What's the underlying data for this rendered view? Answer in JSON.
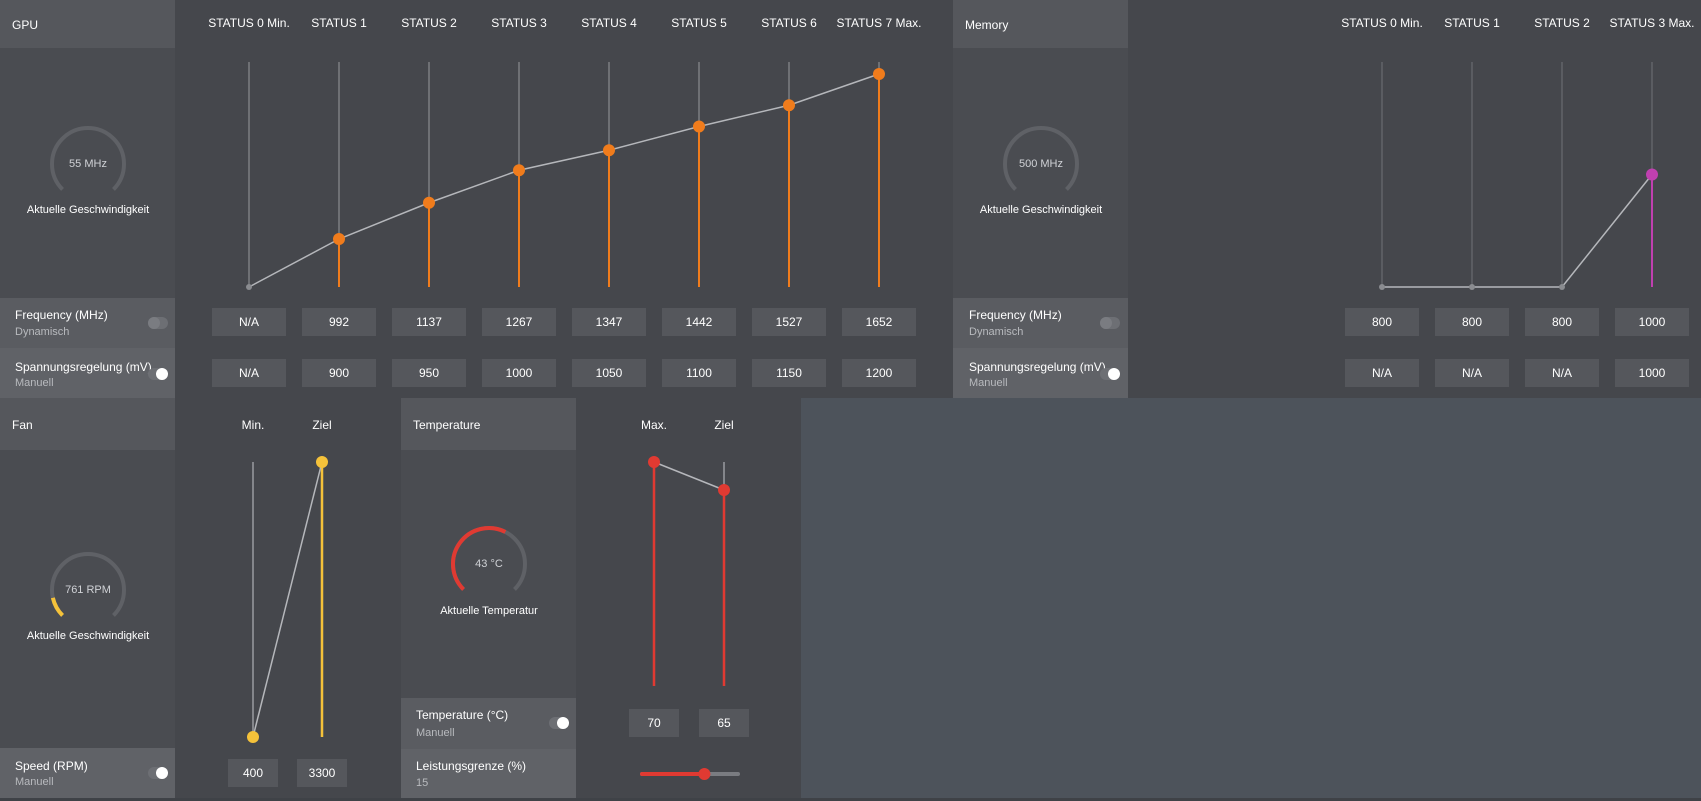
{
  "gpu": {
    "title": "GPU",
    "states": [
      "STATUS 0 Min.",
      "STATUS 1",
      "STATUS 2",
      "STATUS 3",
      "STATUS 4",
      "STATUS 5",
      "STATUS 6",
      "STATUS 7 Max."
    ],
    "gauge": {
      "value": "55 MHz",
      "label": "Aktuelle Geschwindigkeit",
      "fill_fraction": 0.0
    },
    "frequency": {
      "label": "Frequency (MHz)",
      "mode": "Dynamisch",
      "toggle_on": false,
      "values": [
        "N/A",
        "992",
        "1137",
        "1267",
        "1347",
        "1442",
        "1527",
        "1652"
      ]
    },
    "voltage": {
      "label": "Spannungsregelung (mV)",
      "mode": "Manuell",
      "toggle_on": true,
      "values": [
        "N/A",
        "900",
        "950",
        "1000",
        "1050",
        "1100",
        "1150",
        "1200"
      ]
    },
    "accent": "#f07c1c"
  },
  "memory": {
    "title": "Memory",
    "states": [
      "STATUS 0 Min.",
      "STATUS 1",
      "STATUS 2",
      "STATUS 3 Max."
    ],
    "gauge": {
      "value": "500 MHz",
      "label": "Aktuelle Geschwindigkeit",
      "fill_fraction": 0.0
    },
    "frequency": {
      "label": "Frequency (MHz)",
      "mode": "Dynamisch",
      "toggle_on": false,
      "values": [
        "800",
        "800",
        "800",
        "1000"
      ]
    },
    "voltage": {
      "label": "Spannungsregelung (mV)",
      "mode": "Manuell",
      "toggle_on": true,
      "values": [
        "N/A",
        "N/A",
        "N/A",
        "1000"
      ]
    },
    "accent": "#c040b0"
  },
  "fan": {
    "title": "Fan",
    "cols": [
      "Min.",
      "Ziel"
    ],
    "gauge": {
      "value": "761 RPM",
      "label": "Aktuelle Geschwindigkeit",
      "fill_fraction": 0.12
    },
    "speed": {
      "label": "Speed (RPM)",
      "mode": "Manuell",
      "toggle_on": true,
      "values": [
        "400",
        "3300"
      ]
    },
    "accent": "#f5c23a"
  },
  "temperature": {
    "title": "Temperature",
    "cols": [
      "Max.",
      "Ziel"
    ],
    "gauge": {
      "value": "43 °C",
      "label": "Aktuelle Temperatur",
      "fill_fraction": 0.6
    },
    "temp": {
      "label": "Temperature (°C)",
      "mode": "Manuell",
      "toggle_on": true,
      "values": [
        "70",
        "65"
      ]
    },
    "power": {
      "label": "Leistungsgrenze (%)",
      "value": "15",
      "slider_fraction": 0.65
    },
    "accent": "#e03a32"
  }
}
